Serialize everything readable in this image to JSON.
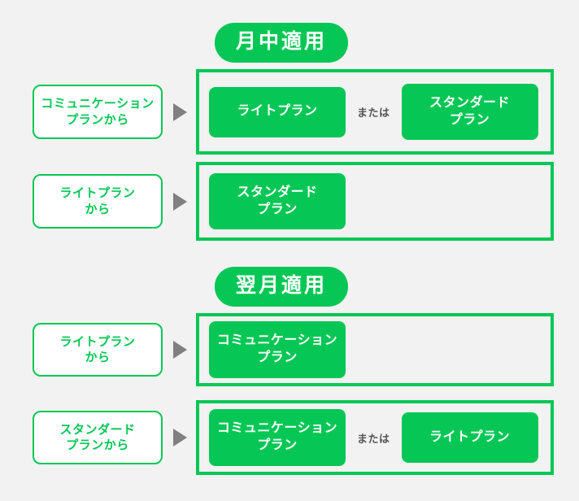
{
  "sections": [
    {
      "badge": "月中適用",
      "rows": [
        {
          "from": "コミュニケーション\nプランから",
          "or_label": "または",
          "options": [
            "ライトプラン",
            "スタンダード\nプラン"
          ]
        },
        {
          "from": "ライトプラン\nから",
          "or_label": "",
          "options": [
            "スタンダード\nプラン"
          ]
        }
      ]
    },
    {
      "badge": "翌月適用",
      "rows": [
        {
          "from": "ライトプラン\nから",
          "or_label": "",
          "options": [
            "コミュニケーション\nプラン"
          ]
        },
        {
          "from": "スタンダード\nプランから",
          "or_label": "または",
          "options": [
            "コミュニケーション\nプラン",
            "ライトプラン"
          ]
        }
      ]
    }
  ],
  "colors": {
    "brand_green": "#06c755",
    "background": "#f2f2f2",
    "arrow_gray": "#808080",
    "or_text": "#555555",
    "chip_text": "#ffffff"
  }
}
